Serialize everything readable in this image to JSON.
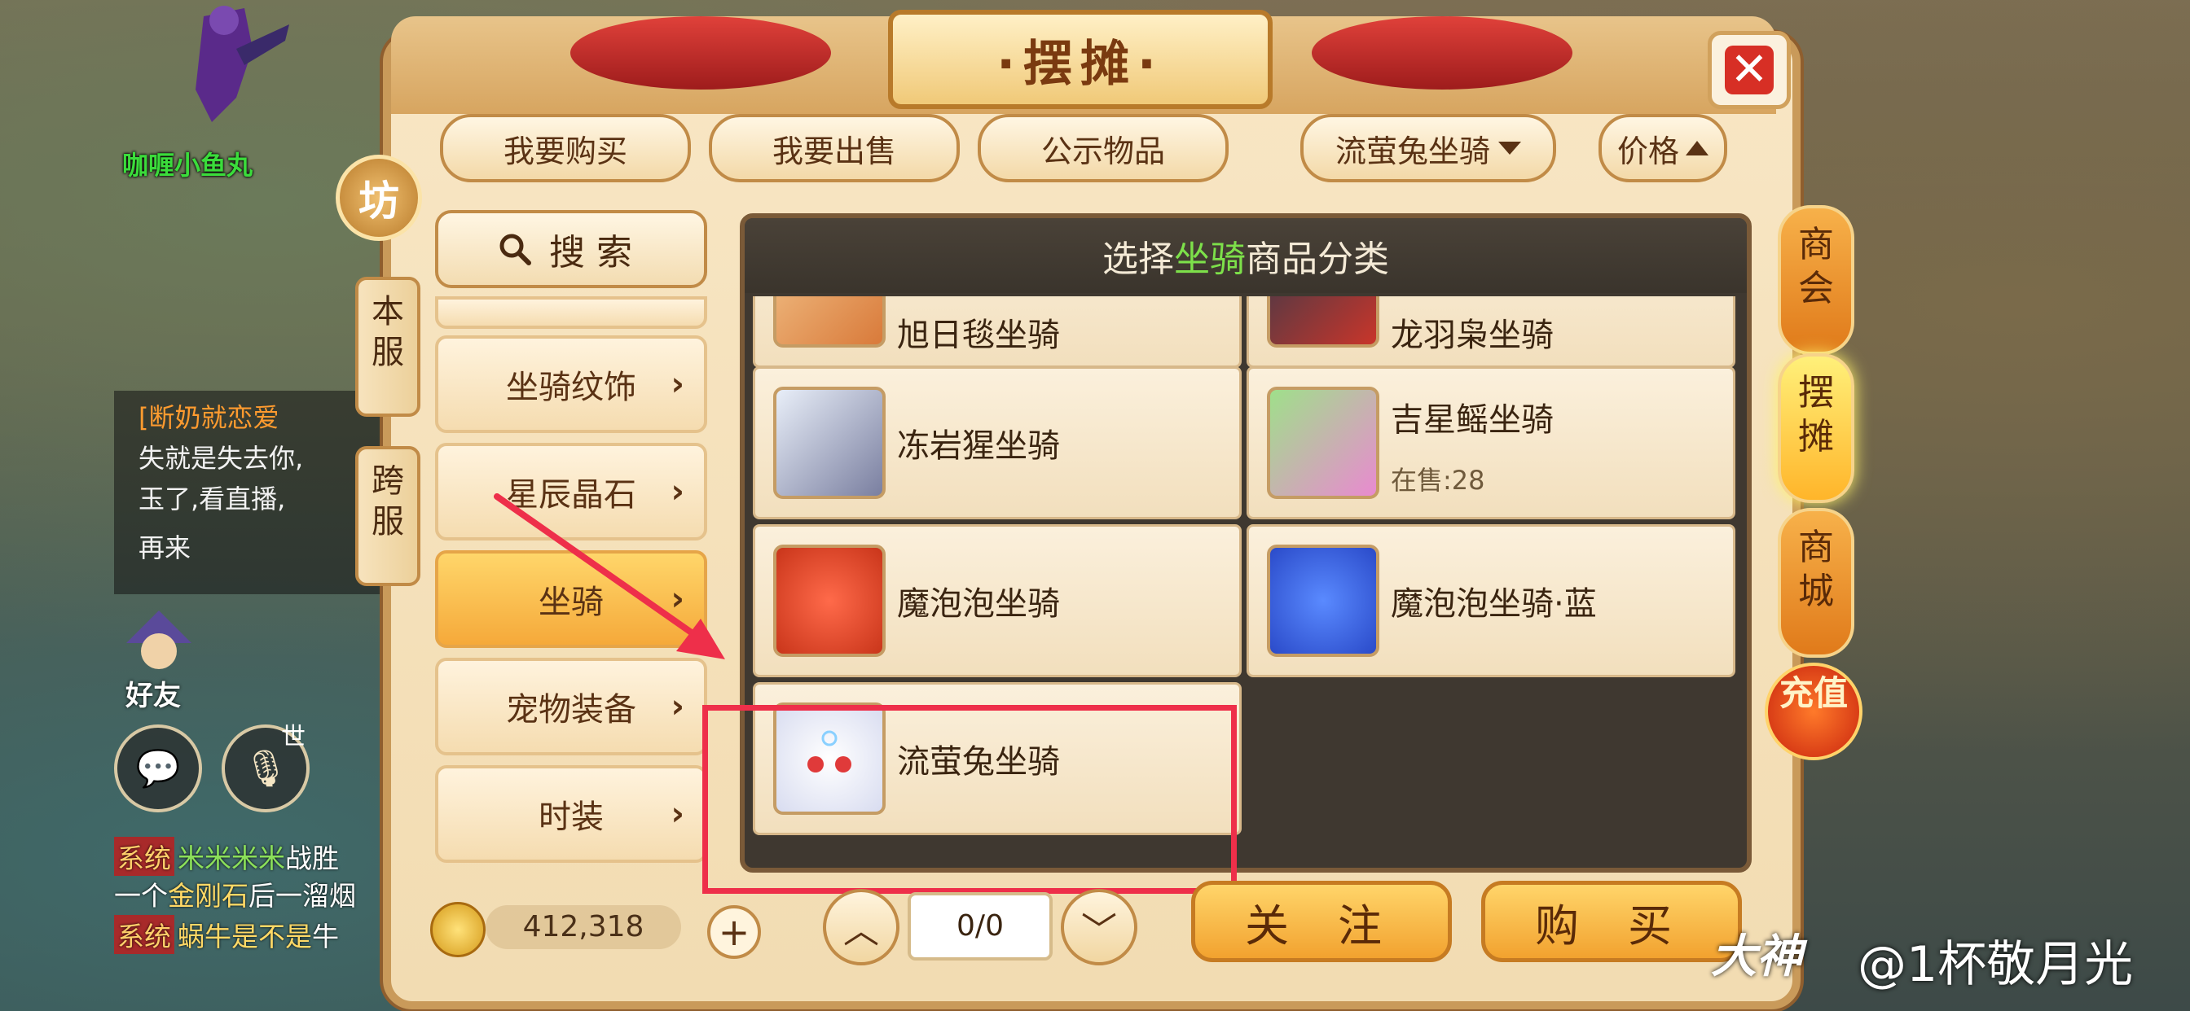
{
  "player": {
    "name": "咖喱小鱼丸"
  },
  "chat": {
    "lines": [
      {
        "text": "[断奶就恋爱"
      },
      {
        "text": "失就是失去你,"
      },
      {
        "text": "玉了,看直播,"
      },
      {
        "text": "再来"
      }
    ],
    "friend_label": "好友",
    "world_tag": "世",
    "system_tag": "系统",
    "system_lines": [
      {
        "name": "米米米米",
        "text": "战胜"
      },
      {
        "prefix": "一个",
        "item": "金刚石",
        "text": "后一溜烟"
      },
      {
        "name": "蜗牛是不是",
        "text": "牛"
      }
    ]
  },
  "panel": {
    "title": "·摆摊·",
    "close_icon": "close-icon",
    "tabs": {
      "buy": "我要购买",
      "sell": "我要出售",
      "public": "公示物品",
      "filter": "流萤兔坐骑",
      "sort": "价格"
    },
    "side": {
      "fang": "坊",
      "local": "本服",
      "cross": "跨服"
    },
    "search": "搜索",
    "categories": [
      {
        "label": "坐骑纹饰"
      },
      {
        "label": "星辰晶石"
      },
      {
        "label": "坐骑"
      },
      {
        "label": "宠物装备"
      },
      {
        "label": "时装"
      }
    ],
    "content_header": {
      "prefix": "选择",
      "highlight": "坐骑",
      "suffix": "商品分类"
    },
    "items": [
      {
        "name": "旭日毯坐骑",
        "on_sale": ""
      },
      {
        "name": "龙羽枭坐骑",
        "on_sale": ""
      },
      {
        "name": "冻岩猩坐骑",
        "on_sale": ""
      },
      {
        "name": "吉星鳐坐骑",
        "on_sale": "在售:28"
      },
      {
        "name": "魔泡泡坐骑",
        "on_sale": ""
      },
      {
        "name": "魔泡泡坐骑·蓝",
        "on_sale": ""
      },
      {
        "name": "流萤兔坐骑",
        "on_sale": ""
      }
    ],
    "coins": "412,318",
    "page": "0/0",
    "follow": "关注",
    "buy_btn": "购买"
  },
  "right_tabs": {
    "chamber": "商会",
    "stall": "摆摊",
    "mall": "商城",
    "recharge": "充值"
  },
  "watermark": {
    "logo": "大神",
    "user": "@1杯敬月光"
  },
  "colors": {
    "highlight_red": "#ee2f4a",
    "accent_green": "#7de04a",
    "panel_bg": "#f2dcb2"
  }
}
